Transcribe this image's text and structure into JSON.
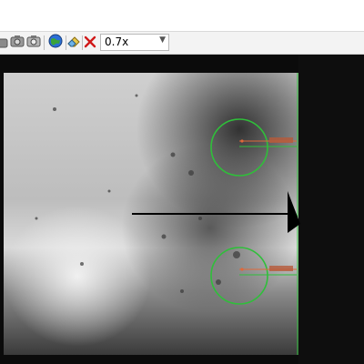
{
  "toolbar": {
    "buttons": [
      {
        "name": "camera-snapshot",
        "icon": "camera-icon"
      },
      {
        "name": "camera-capture",
        "icon": "camera-icon"
      },
      {
        "name": "globe",
        "icon": "globe-icon"
      },
      {
        "name": "clear-overlay",
        "icon": "eraser-icon"
      },
      {
        "name": "close",
        "icon": "close-icon"
      }
    ],
    "zoom": {
      "value": "0.7x"
    }
  },
  "colors": {
    "overlay_circle": "#2fbf3a",
    "overlay_measure": "#e0683a",
    "frame_line": "#2fbf3a",
    "arrow": "#000000"
  }
}
